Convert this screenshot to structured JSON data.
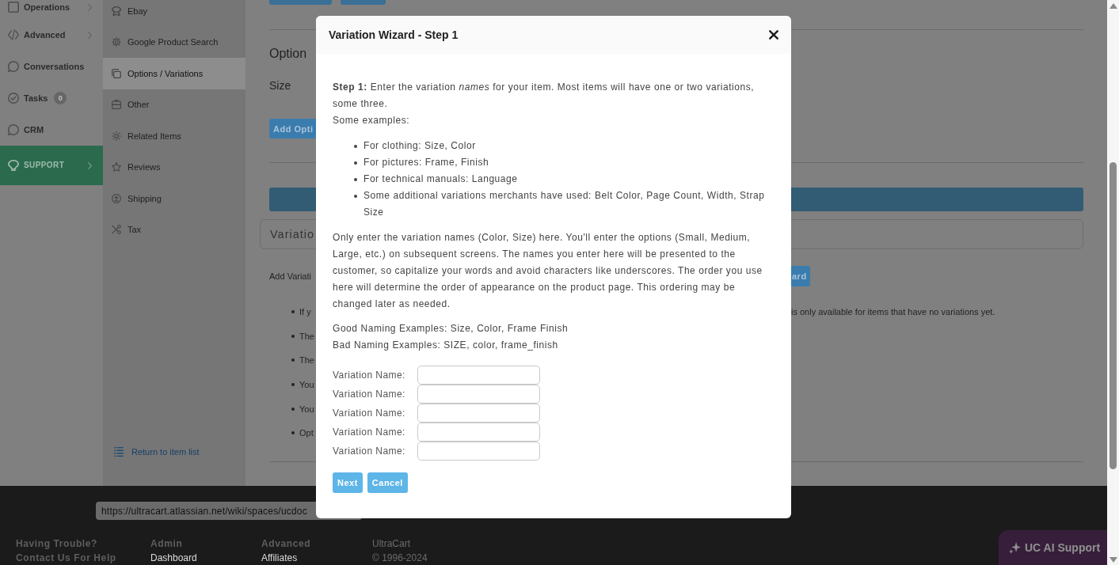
{
  "main_nav": {
    "items": [
      {
        "label": "Operations",
        "expandable": true,
        "selected": false
      },
      {
        "label": "Advanced",
        "expandable": true,
        "selected": false
      },
      {
        "label": "Conversations",
        "expandable": false,
        "selected": false
      },
      {
        "label": "Tasks",
        "badge": "0",
        "expandable": false,
        "selected": false
      },
      {
        "label": "CRM",
        "expandable": false,
        "selected": false
      },
      {
        "label": "SUPPORT",
        "expandable": true,
        "selected": true
      }
    ]
  },
  "item_nav": {
    "items": [
      {
        "label": "Ebay",
        "selected": false
      },
      {
        "label": "Google Product Search",
        "selected": false
      },
      {
        "label": "Options / Variations",
        "selected": true
      },
      {
        "label": "Other",
        "selected": false
      },
      {
        "label": "Related Items",
        "selected": false
      },
      {
        "label": "Reviews",
        "selected": false
      },
      {
        "label": "Shipping",
        "selected": false
      },
      {
        "label": "Tax",
        "selected": false
      }
    ],
    "return_link": "Return to item list"
  },
  "content": {
    "option_heading": "Option",
    "option_name": "Size",
    "add_option_button": "Add Opti",
    "variations_panel_title": "Variatio",
    "add_variation_text": "Add Variati",
    "wizard_button": "ard",
    "notes": [
      {
        "text": "If y",
        "continuation": "is only available for items that have no variations yet."
      },
      {
        "text": "The"
      },
      {
        "text": "The"
      },
      {
        "text": "You"
      },
      {
        "text": "You"
      },
      {
        "text": "Opt"
      }
    ]
  },
  "url_tooltip": "https://ultracart.atlassian.net/wiki/spaces/ucdoc",
  "modal": {
    "title": "Variation Wizard - Step 1",
    "intro": "**Step 1:** Enter the variation *names* for your item. Most items will have one or two variations, some three.",
    "examples_label": "Some examples:",
    "examples": [
      "For clothing: Size, Color",
      "For pictures: Frame, Finish",
      "For technical manuals: Language",
      "Some additional variations merchants have used: Belt Color, Page Count, Width, Strap Size"
    ],
    "explanation": "Only enter the variation names (Color, Size) here. You'll enter the options (Small, Medium, Large, etc.) on subsequent screens. The names you enter here will be presented to the customer, so capitalize your words and avoid characters like underscores. The order you use here will determine the order of appearance on the product page. This ordering may be changed later as needed.",
    "good_examples": "Good Naming Examples: Size, Color, Frame Finish",
    "bad_examples": "Bad Naming Examples: SIZE, color, frame_finish",
    "fields": [
      {
        "label": "Variation Name:"
      },
      {
        "label": "Variation Name:"
      },
      {
        "label": "Variation Name:"
      },
      {
        "label": "Variation Name:"
      },
      {
        "label": "Variation Name:"
      }
    ],
    "buttons": [
      {
        "label": "Next"
      },
      {
        "label": "Cancel"
      }
    ]
  },
  "footer": {
    "columns": [
      {
        "lines": [
          {
            "kind": "heading",
            "text": "Having Trouble?"
          },
          {
            "kind": "heading",
            "text": "Contact Us For Help"
          }
        ]
      },
      {
        "lines": [
          {
            "kind": "heading",
            "text": "Admin"
          },
          {
            "kind": "link",
            "text": "Dashboard"
          }
        ]
      },
      {
        "lines": [
          {
            "kind": "heading",
            "text": "Advanced"
          },
          {
            "kind": "link",
            "text": "Affiliates"
          }
        ]
      },
      {
        "lines": [
          {
            "kind": "plain",
            "text": "UltraCart"
          },
          {
            "kind": "plain",
            "text": "© 1996-2024"
          }
        ]
      }
    ]
  },
  "ai_support_button": "UC AI Support"
}
